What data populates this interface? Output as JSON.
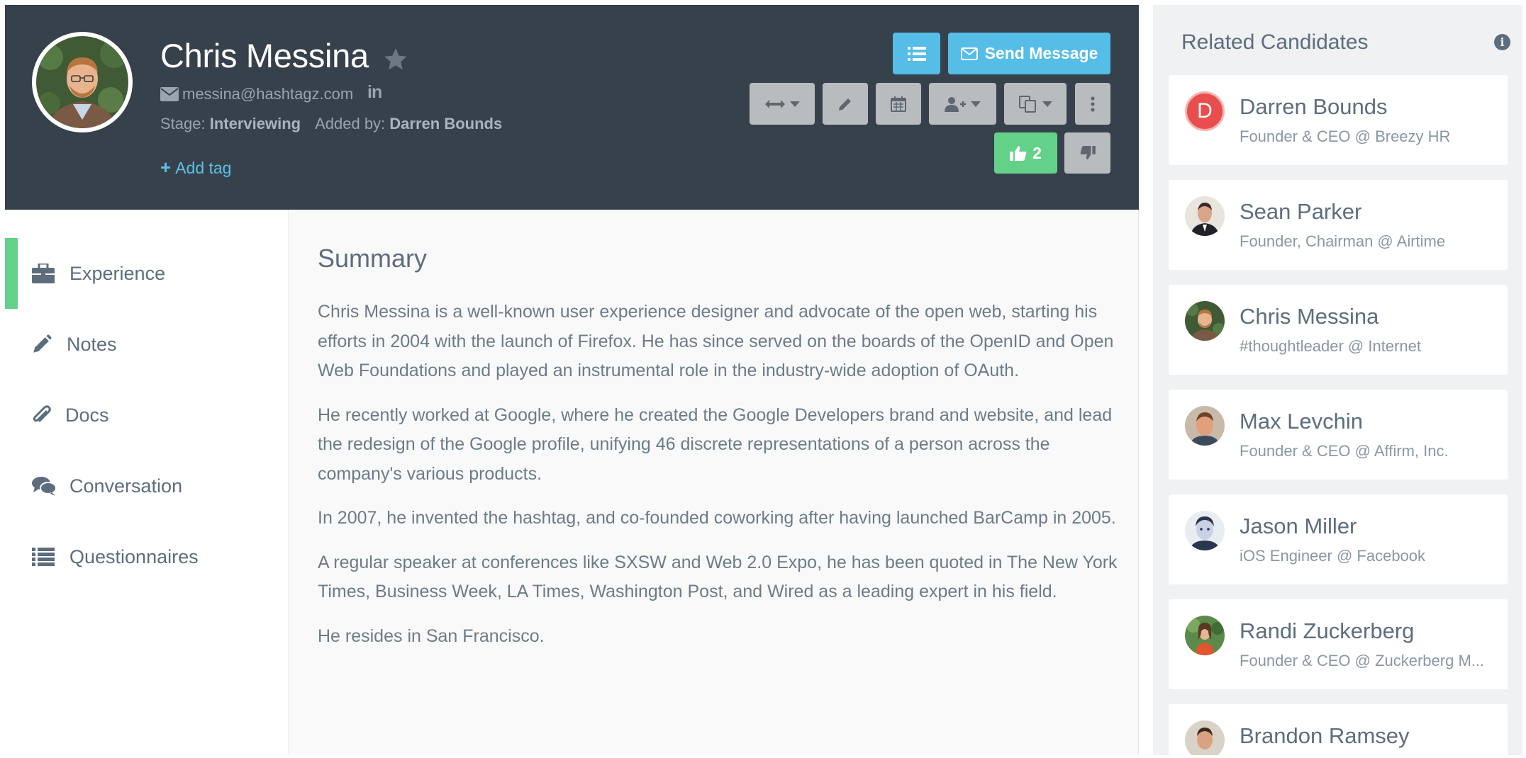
{
  "candidate": {
    "name": "Chris Messina",
    "email": "messina@hashtagz.com",
    "linkedin_label": "in",
    "stage_label": "Stage:",
    "stage_value": "Interviewing",
    "added_by_label": "Added by:",
    "added_by_value": "Darren Bounds",
    "add_tag_label": "Add tag"
  },
  "toolbar": {
    "send_message_label": "Send Message",
    "upvote_count": "2"
  },
  "nav": {
    "items": [
      {
        "label": "Experience",
        "icon": "briefcase-icon",
        "active": true
      },
      {
        "label": "Notes",
        "icon": "pencil-icon",
        "active": false
      },
      {
        "label": "Docs",
        "icon": "paperclip-icon",
        "active": false
      },
      {
        "label": "Conversation",
        "icon": "comments-icon",
        "active": false
      },
      {
        "label": "Questionnaires",
        "icon": "list-icon",
        "active": false
      }
    ]
  },
  "summary": {
    "title": "Summary",
    "paragraphs": [
      "Chris Messina is a well-known user experience designer and advocate of the open web, starting his efforts in 2004 with the launch of Firefox. He has since served on the boards of the OpenID and Open Web Foundations and played an instrumental role in the industry-wide adoption of OAuth.",
      "He recently worked at Google, where he created the Google Developers brand and website, and lead the redesign of the Google profile, unifying 46 discrete representations of a person across the company's various products.",
      "In 2007, he invented the hashtag, and co-founded coworking after having launched BarCamp in 2005.",
      "A regular speaker at conferences like SXSW and Web 2.0 Expo, he has been quoted in The New York Times, Business Week, LA Times, Washington Post, and Wired as a leading expert in his field.",
      "He resides in San Francisco."
    ]
  },
  "related": {
    "title": "Related Candidates",
    "items": [
      {
        "name": "Darren Bounds",
        "title": "Founder & CEO @ Breezy HR",
        "avatar_letter": "D"
      },
      {
        "name": "Sean Parker",
        "title": "Founder, Chairman @ Airtime"
      },
      {
        "name": "Chris Messina",
        "title": "#thoughtleader @ Internet"
      },
      {
        "name": "Max Levchin",
        "title": "Founder & CEO @ Affirm, Inc."
      },
      {
        "name": "Jason Miller",
        "title": "iOS Engineer @ Facebook"
      },
      {
        "name": "Randi Zuckerberg",
        "title": "Founder & CEO @ Zuckerberg M..."
      },
      {
        "name": "Brandon Ramsey",
        "title": ""
      }
    ]
  },
  "colors": {
    "header_bg": "#37414c",
    "accent_blue": "#55bde6",
    "accent_green": "#64d189",
    "button_grey": "#b9bcbf",
    "sidebar_bg": "#eff1f3"
  }
}
